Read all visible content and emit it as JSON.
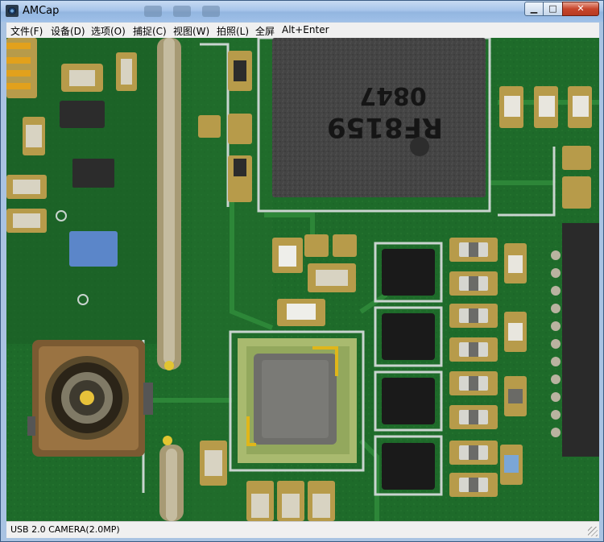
{
  "window": {
    "title": "AMCap",
    "app_icon": "webcam-icon",
    "controls": {
      "minimize_icon": "minimize-icon",
      "maximize_icon": "maximize-icon",
      "close_icon": "close-icon",
      "minimize_glyph": "▁",
      "maximize_glyph": "□",
      "close_glyph": "✕"
    }
  },
  "menu": {
    "items": [
      {
        "label": "文件(F)"
      },
      {
        "label": "设备(D)"
      },
      {
        "label": "选项(O)"
      },
      {
        "label": "捕捉(C)"
      },
      {
        "label": "视图(W)"
      },
      {
        "label": "拍照(L)"
      },
      {
        "label": "全屏"
      },
      {
        "label": "Alt+Enter"
      }
    ]
  },
  "video": {
    "description_icon": "pcb-microscope-feed",
    "chip_marking_line1": "RF8159",
    "chip_marking_line2": "0847",
    "colors": {
      "board": "#1f6b2a",
      "trace": "#2f8a3a",
      "silk": "#c9d4cf",
      "chip": "#3b3b3b",
      "pad": "#b79b4a"
    }
  },
  "status": {
    "text": "USB 2.0 CAMERA(2.0MP)"
  }
}
